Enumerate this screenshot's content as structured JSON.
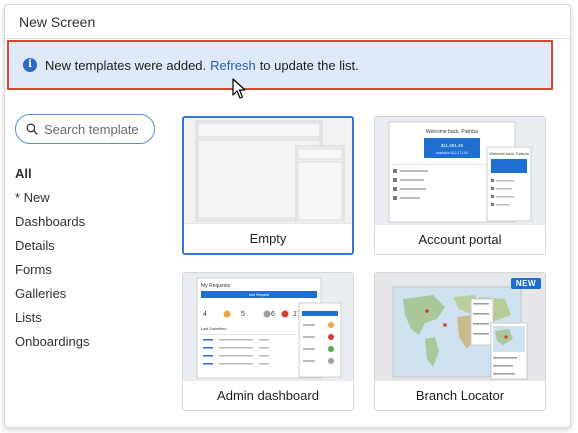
{
  "dialog": {
    "title": "New Screen"
  },
  "banner": {
    "text_before": "New templates were added.",
    "link": "Refresh",
    "text_after": "to update the list."
  },
  "search": {
    "placeholder": "Search template",
    "value": ""
  },
  "categories": [
    "All",
    "* New",
    "Dashboards",
    "Details",
    "Forms",
    "Galleries",
    "Lists",
    "Onboardings"
  ],
  "selected_category": "All",
  "templates": [
    {
      "label": "Empty",
      "selected": true
    },
    {
      "label": "Account portal",
      "preview": {
        "welcome": "Welcome back, Patricia",
        "welcome_short": "Welcome back, Patricia",
        "amount": "$11,681.45",
        "sub": "available $12,171.93"
      }
    },
    {
      "label": "Admin dashboard",
      "preview": {
        "title": "My Requests",
        "button": "Add Request",
        "stats": [
          "4",
          "5",
          "6",
          "17"
        ],
        "section": "Last Submitted"
      }
    },
    {
      "label": "Branch Locator",
      "badge": "NEW"
    }
  ],
  "colors": {
    "accent": "#2f78d6",
    "banner_bg": "#dfe9f7",
    "highlight": "#d9472a",
    "link": "#2263b8",
    "badge": "#1f6fd1"
  },
  "icons": [
    "info-icon",
    "search-icon",
    "cursor-icon"
  ]
}
